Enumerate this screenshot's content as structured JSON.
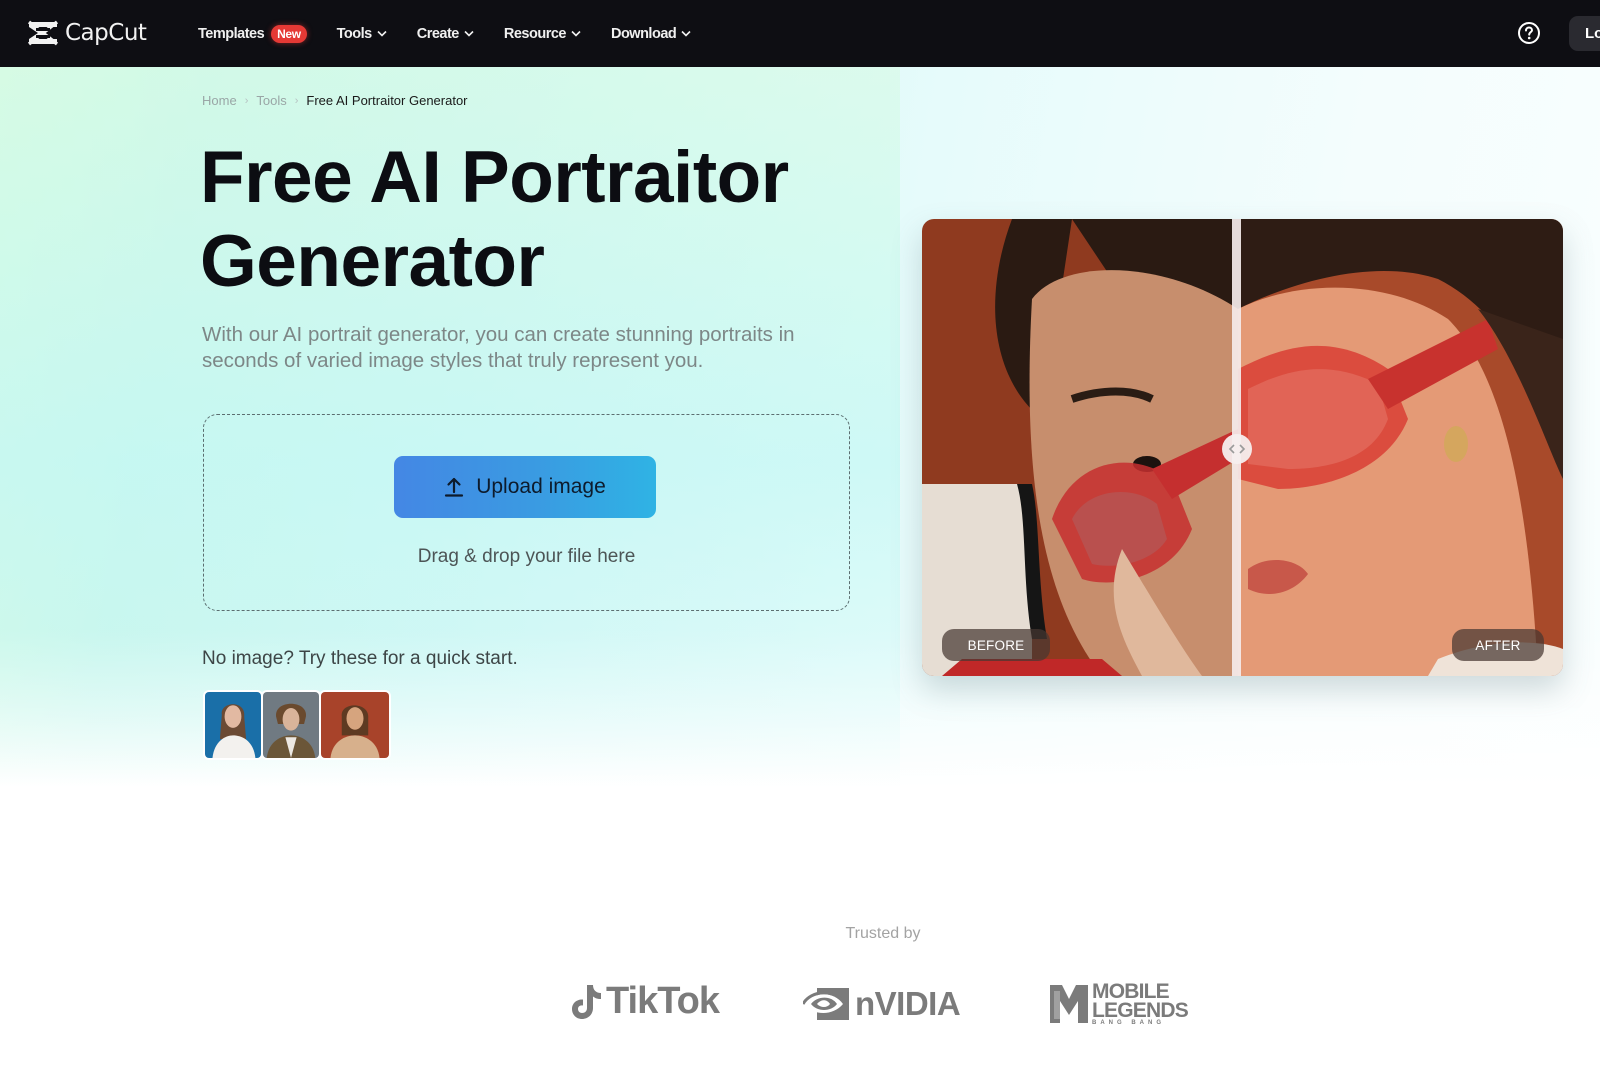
{
  "navbar": {
    "brand": "CapCut",
    "items": [
      {
        "label": "Templates",
        "badge": "New",
        "has_dropdown": false
      },
      {
        "label": "Tools",
        "has_dropdown": true
      },
      {
        "label": "Create",
        "has_dropdown": true
      },
      {
        "label": "Resource",
        "has_dropdown": true
      },
      {
        "label": "Download",
        "has_dropdown": true
      }
    ],
    "help_icon": "question-circle-icon",
    "login_label": "Log in",
    "badge_color": "#e53935",
    "background": "#0e0e13"
  },
  "breadcrumb": {
    "items": [
      "Home",
      "Tools"
    ],
    "current": "Free AI Portraitor Generator"
  },
  "hero": {
    "title": "Free AI Portraitor Generator",
    "subtitle": "With our AI portrait generator, you can create stunning portraits in seconds of varied image styles that truly represent you.",
    "upload_button": "Upload image",
    "upload_icon": "upload-arrow-icon",
    "drop_hint": "Drag & drop your file here",
    "quickstart_label": "No image? Try these for a quick start.",
    "samples": [
      {
        "name": "sample-woman-blue-background"
      },
      {
        "name": "sample-man-grey-background"
      },
      {
        "name": "sample-woman-rust-background"
      }
    ],
    "button_gradient": [
      "#4487e4",
      "#2fb3e4"
    ]
  },
  "comparison": {
    "before_label": "BEFORE",
    "after_label": "AFTER",
    "handle_icon": "chevron-left-right-icon"
  },
  "trusted": {
    "label": "Trusted by",
    "logos": [
      {
        "name": "TikTok",
        "text": "TikTok"
      },
      {
        "name": "NVIDIA",
        "text": "nVIDIA"
      },
      {
        "name": "Mobile Legends",
        "line1": "MOBILE",
        "line2": "LEGENDS",
        "sub": "BANG BANG"
      }
    ]
  }
}
